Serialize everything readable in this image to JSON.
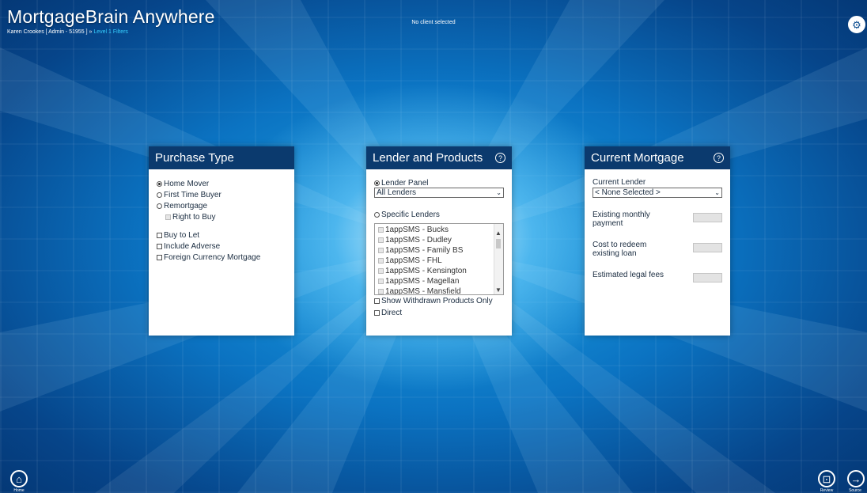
{
  "header": {
    "app_title": "MortgageBrain Anywhere",
    "user_info": "Karen Crookes [ Admin - 51955 ] »",
    "level_link": "Level 1 Filters",
    "client_status": "No client selected"
  },
  "purchase_type": {
    "title": "Purchase Type",
    "options": [
      {
        "label": "Home Mover",
        "checked": true
      },
      {
        "label": "First Time Buyer",
        "checked": false
      },
      {
        "label": "Remortgage",
        "checked": false
      }
    ],
    "right_to_buy": "Right to Buy",
    "checkboxes": [
      "Buy to Let",
      "Include Adverse",
      "Foreign Currency Mortgage"
    ]
  },
  "lender_products": {
    "title": "Lender and Products",
    "help_icon": "?",
    "lender_panel_label": "Lender Panel",
    "lender_panel_value": "All Lenders",
    "specific_lenders_label": "Specific Lenders",
    "lenders": [
      "1appSMS - Bucks",
      "1appSMS - Dudley",
      "1appSMS - Family BS",
      "1appSMS - FHL",
      "1appSMS - Kensington",
      "1appSMS - Magellan",
      "1appSMS - Mansfield"
    ],
    "show_withdrawn": "Show Withdrawn Products Only",
    "direct": "Direct"
  },
  "current_mortgage": {
    "title": "Current Mortgage",
    "help_icon": "?",
    "current_lender_label": "Current Lender",
    "current_lender_value": "< None Selected >",
    "fields": [
      {
        "label": "Existing monthly payment"
      },
      {
        "label": "Cost to redeem existing loan"
      },
      {
        "label": "Estimated legal fees"
      }
    ]
  },
  "footer": {
    "home_caption": "Home",
    "review_caption": "Review",
    "source_caption": "Source"
  },
  "colors": {
    "panel_header": "#0b3a6e",
    "background_center": "#1fa6e6",
    "background_edge": "#032c63"
  }
}
